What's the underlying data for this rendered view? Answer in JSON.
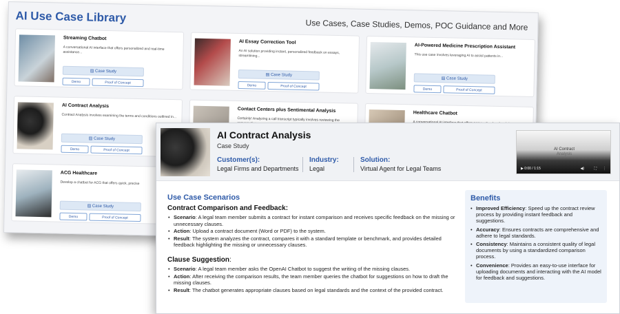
{
  "library": {
    "title": "AI Use Case Library",
    "subtitle": "Use Cases, Case Studies, Demos, POC Guidance and More",
    "case_study_label": "Case Study",
    "demo_label": "Demo",
    "poc_label": "Proof of Concept",
    "cards": [
      {
        "title": "Streaming Chatbot",
        "desc": "A conversational AI interface that offers personalized and real-time assistance..."
      },
      {
        "title": "AI Essay Correction Tool",
        "desc": "An AI solution providing instant, personalized feedback on essays, streamlining..."
      },
      {
        "title": "AI-Powered Medicine Prescription Assistant",
        "desc": "This use case involves leveraging AI to assist patients in..."
      },
      {
        "title": "AI Contract Analysis",
        "desc": "Contract Analysis involves examining the terms and conditions outlined in..."
      },
      {
        "title": "Contact Centers plus Sentimental Analysis",
        "desc": "Certainly! Analyzing a call transcript typically involves reviewing the conversation..."
      },
      {
        "title": "Healthcare Chatbot",
        "desc": "A conversational AI interface that offers personalized and real-time assistance..."
      },
      {
        "title": "ACG Healthcare",
        "desc": "Develop a chatbot for ACG that offers quick, precise"
      }
    ]
  },
  "detail": {
    "title": "AI Contract Analysis",
    "type": "Case Study",
    "customer_label": "Customer(s):",
    "customer_value": "Legal Firms and Departments",
    "industry_label": "Industry:",
    "industry_value": "Legal",
    "solution_label": "Solution:",
    "solution_value": "Virtual Agent for Legal Teams",
    "video": {
      "title": "AI Contract",
      "subtitle": "Analysis",
      "time": "0:00 / 1:15"
    },
    "section_title": "Use Case Scenarios",
    "scenario1": {
      "heading": "Contract Comparison and Feedback:",
      "items": [
        {
          "label": "Scenario",
          "text": ": A legal team member submits a contract for instant comparison and receives specific feedback on the missing or unnecessary clauses."
        },
        {
          "label": "Action",
          "text": ": Upload a contract document (Word or PDF) to the system."
        },
        {
          "label": "Result",
          "text": ": The system analyzes the contract, compares it with a standard template or benchmark, and provides detailed feedback highlighting the missing or unnecessary clauses."
        }
      ]
    },
    "scenario2": {
      "heading": "Clause Suggestion",
      "heading_suffix": ":",
      "items": [
        {
          "label": "Scenario",
          "text": ": A legal team member asks the OpenAI Chatbot to suggest the writing of the missing clauses."
        },
        {
          "label": "Action",
          "text": ": After receiving the comparison results, the team member queries the chatbot for suggestions on how to draft the missing clauses."
        },
        {
          "label": "Result",
          "text": ": The chatbot generates appropriate clauses based on legal standards and the context of the provided contract."
        }
      ]
    },
    "benefits": {
      "title": "Benefits",
      "items": [
        {
          "label": "Improved Efficiency",
          "text": ": Speed up the contract review process by providing instant feedback and suggestions."
        },
        {
          "label": "Accuracy",
          "text": ": Ensures contracts are comprehensive and adhere to legal standards."
        },
        {
          "label": "Consistency",
          "text": ": Maintains a consistent quality of legal documents by using a standardized comparison process."
        },
        {
          "label": "Convenience",
          "text": ": Provides an easy-to-use interface for uploading documents and interacting with the AI model for feedback and suggestions."
        }
      ]
    }
  }
}
